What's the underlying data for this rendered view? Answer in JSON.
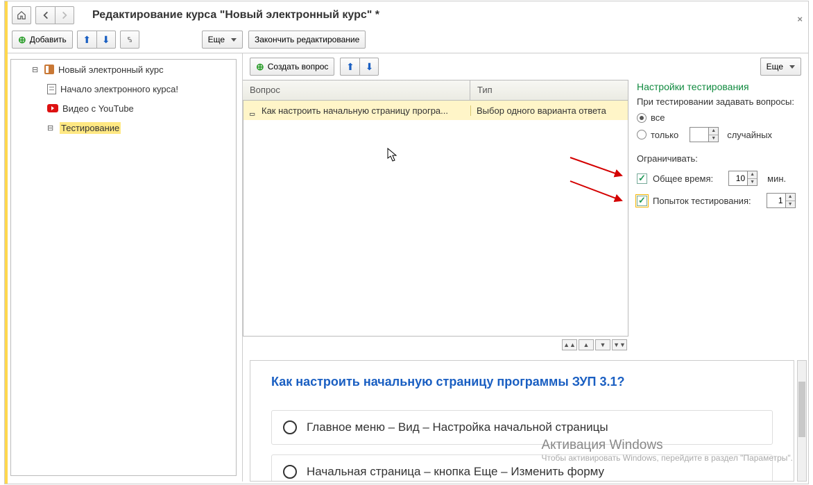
{
  "header": {
    "title": "Редактирование курса \"Новый электронный курс\" *"
  },
  "leftToolbar": {
    "addLabel": "Добавить",
    "moreLabel": "Еще"
  },
  "rightToolbar": {
    "finishLabel": "Закончить редактирование",
    "createLabel": "Создать вопрос",
    "moreLabel": "Еще"
  },
  "tree": {
    "root": "Новый электронный курс",
    "items": [
      {
        "label": "Начало электронного курса!"
      },
      {
        "label": "Видео с YouTube"
      },
      {
        "label": "Тестирование"
      }
    ]
  },
  "grid": {
    "cols": {
      "question": "Вопрос",
      "type": "Тип"
    },
    "row": {
      "question": "Как настроить начальную страницу програ...",
      "type": "Выбор одного варианта ответа"
    }
  },
  "settings": {
    "heading": "Настройки тестирования",
    "subtitle": "При тестировании задавать вопросы:",
    "radioAll": "все",
    "radioOnly": "только",
    "randomSuffix": "случайных",
    "limit": "Ограничивать:",
    "totalTime": "Общее время:",
    "totalTimeVal": "10",
    "minSuffix": "мин.",
    "attempts": "Попыток тестирования:",
    "attemptsVal": "1"
  },
  "preview": {
    "question": "Как настроить начальную страницу программы ЗУП 3.1?",
    "opt1": "Главное меню – Вид – Настройка начальной страницы",
    "opt2": "Начальная страница – кнопка Еще – Изменить форму"
  },
  "watermark": {
    "title": "Активация Windows",
    "sub": "Чтобы активировать Windows, перейдите в раздел \"Параметры\"."
  }
}
